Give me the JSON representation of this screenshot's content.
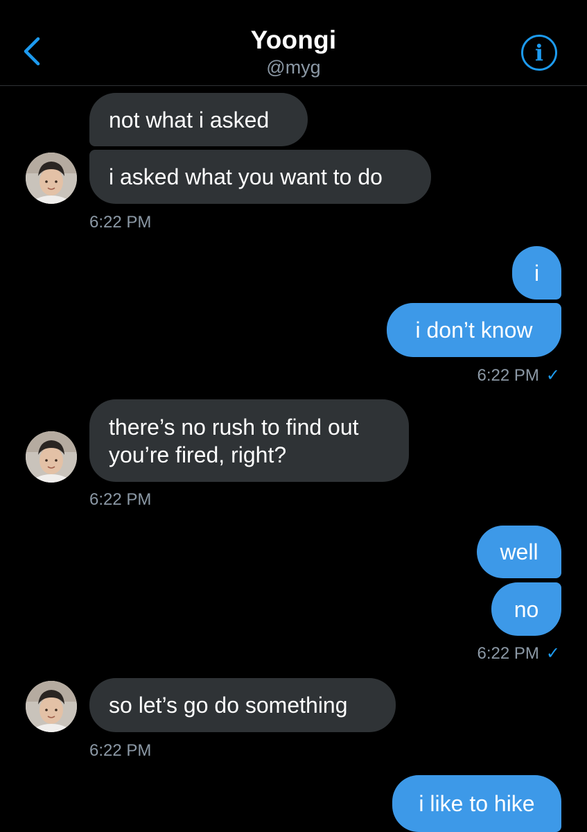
{
  "header": {
    "title": "Yoongi",
    "handle": "@myg"
  },
  "colors": {
    "background": "#000000",
    "received_bubble": "#2f3336",
    "sent_bubble": "#3d99e8",
    "accent": "#1d9bf0",
    "timestamp": "#8b98a5"
  },
  "icons": {
    "back": "chevron-left-icon",
    "info": "info-circle-icon",
    "read_receipt": "checkmark-icon"
  },
  "messages": [
    {
      "direction": "received",
      "text": "not what i asked"
    },
    {
      "direction": "received",
      "text": "i asked what you want to do"
    },
    {
      "direction": "received",
      "time": "6:22 PM"
    },
    {
      "direction": "sent",
      "text": "i"
    },
    {
      "direction": "sent",
      "text": "i don’t know"
    },
    {
      "direction": "sent",
      "time": "6:22 PM",
      "read_check": "✓"
    },
    {
      "direction": "received",
      "text_lines": [
        "there’s no rush to find out",
        "you’re fired, right?"
      ]
    },
    {
      "direction": "received",
      "time": "6:22 PM"
    },
    {
      "direction": "sent",
      "text": "well"
    },
    {
      "direction": "sent",
      "text": "no"
    },
    {
      "direction": "sent",
      "time": "6:22 PM",
      "read_check": "✓"
    },
    {
      "direction": "received",
      "text": "so let’s go do something"
    },
    {
      "direction": "received",
      "time": "6:22 PM"
    },
    {
      "direction": "sent",
      "text": "i like to hike"
    }
  ]
}
